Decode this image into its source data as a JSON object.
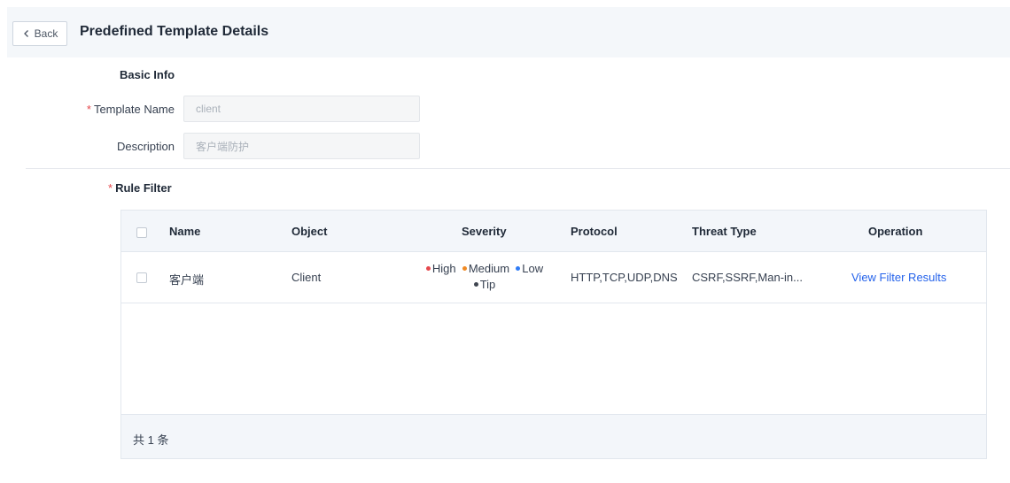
{
  "header": {
    "back_label": "Back",
    "title": "Predefined Template Details"
  },
  "basic_info": {
    "title": "Basic Info",
    "template_name_label": "Template Name",
    "template_name_value": "client",
    "description_label": "Description",
    "description_value": "客户端防护"
  },
  "rule_filter": {
    "title": "Rule Filter",
    "columns": {
      "name": "Name",
      "object": "Object",
      "severity": "Severity",
      "protocol": "Protocol",
      "threat_type": "Threat Type",
      "operation": "Operation"
    },
    "rows": [
      {
        "name": "客户端",
        "object": "Client",
        "severity": [
          {
            "label": "High",
            "color": "#e5484d"
          },
          {
            "label": "Medium",
            "color": "#f08a24"
          },
          {
            "label": "Low",
            "color": "#2f7cf6"
          },
          {
            "label": "Tip",
            "color": "#3f4550"
          }
        ],
        "protocol": "HTTP,TCP,UDP,DNS",
        "threat_type": "CSRF,SSRF,Man-in...",
        "operation": "View Filter Results"
      }
    ],
    "footer_total": "共 1 条"
  },
  "colors": {
    "required": "#e5484d",
    "link": "#2563eb",
    "header_bg": "#f4f7fa"
  },
  "icons": {
    "back": "chevron-left-icon"
  }
}
